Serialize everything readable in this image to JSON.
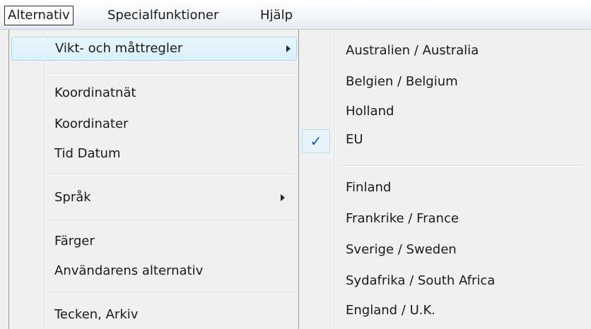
{
  "menubar": {
    "items": [
      {
        "label": "Alternativ",
        "open": true
      },
      {
        "label": "Specialfunktioner"
      },
      {
        "label": "Hjälp"
      }
    ]
  },
  "menu": {
    "items": [
      {
        "label": "Vikt- och måttregler",
        "submenu": true,
        "highlighted": true
      },
      {
        "label": "Koordinatnät"
      },
      {
        "label": "Koordinater"
      },
      {
        "label": "Tid  Datum"
      },
      {
        "label": "Språk",
        "submenu": true
      },
      {
        "label": "Färger"
      },
      {
        "label": "Användarens alternativ"
      },
      {
        "label": "Tecken, Arkiv"
      }
    ]
  },
  "submenu": {
    "items": [
      {
        "label": "Australien / Australia"
      },
      {
        "label": "Belgien / Belgium"
      },
      {
        "label": "Holland"
      },
      {
        "label": "EU",
        "checked": true,
        "check_glyph": "✓"
      },
      {
        "label": "Finland"
      },
      {
        "label": "Frankrike / France"
      },
      {
        "label": "Sverige / Sweden"
      },
      {
        "label": "Sydafrika / South Africa"
      },
      {
        "label": "England / U.K."
      }
    ]
  },
  "colors": {
    "highlight": "#d9f0fc",
    "highlight_border": "#a8d8eb",
    "check": "#1f4fb6",
    "menu_bg": "#f0f0f0"
  }
}
